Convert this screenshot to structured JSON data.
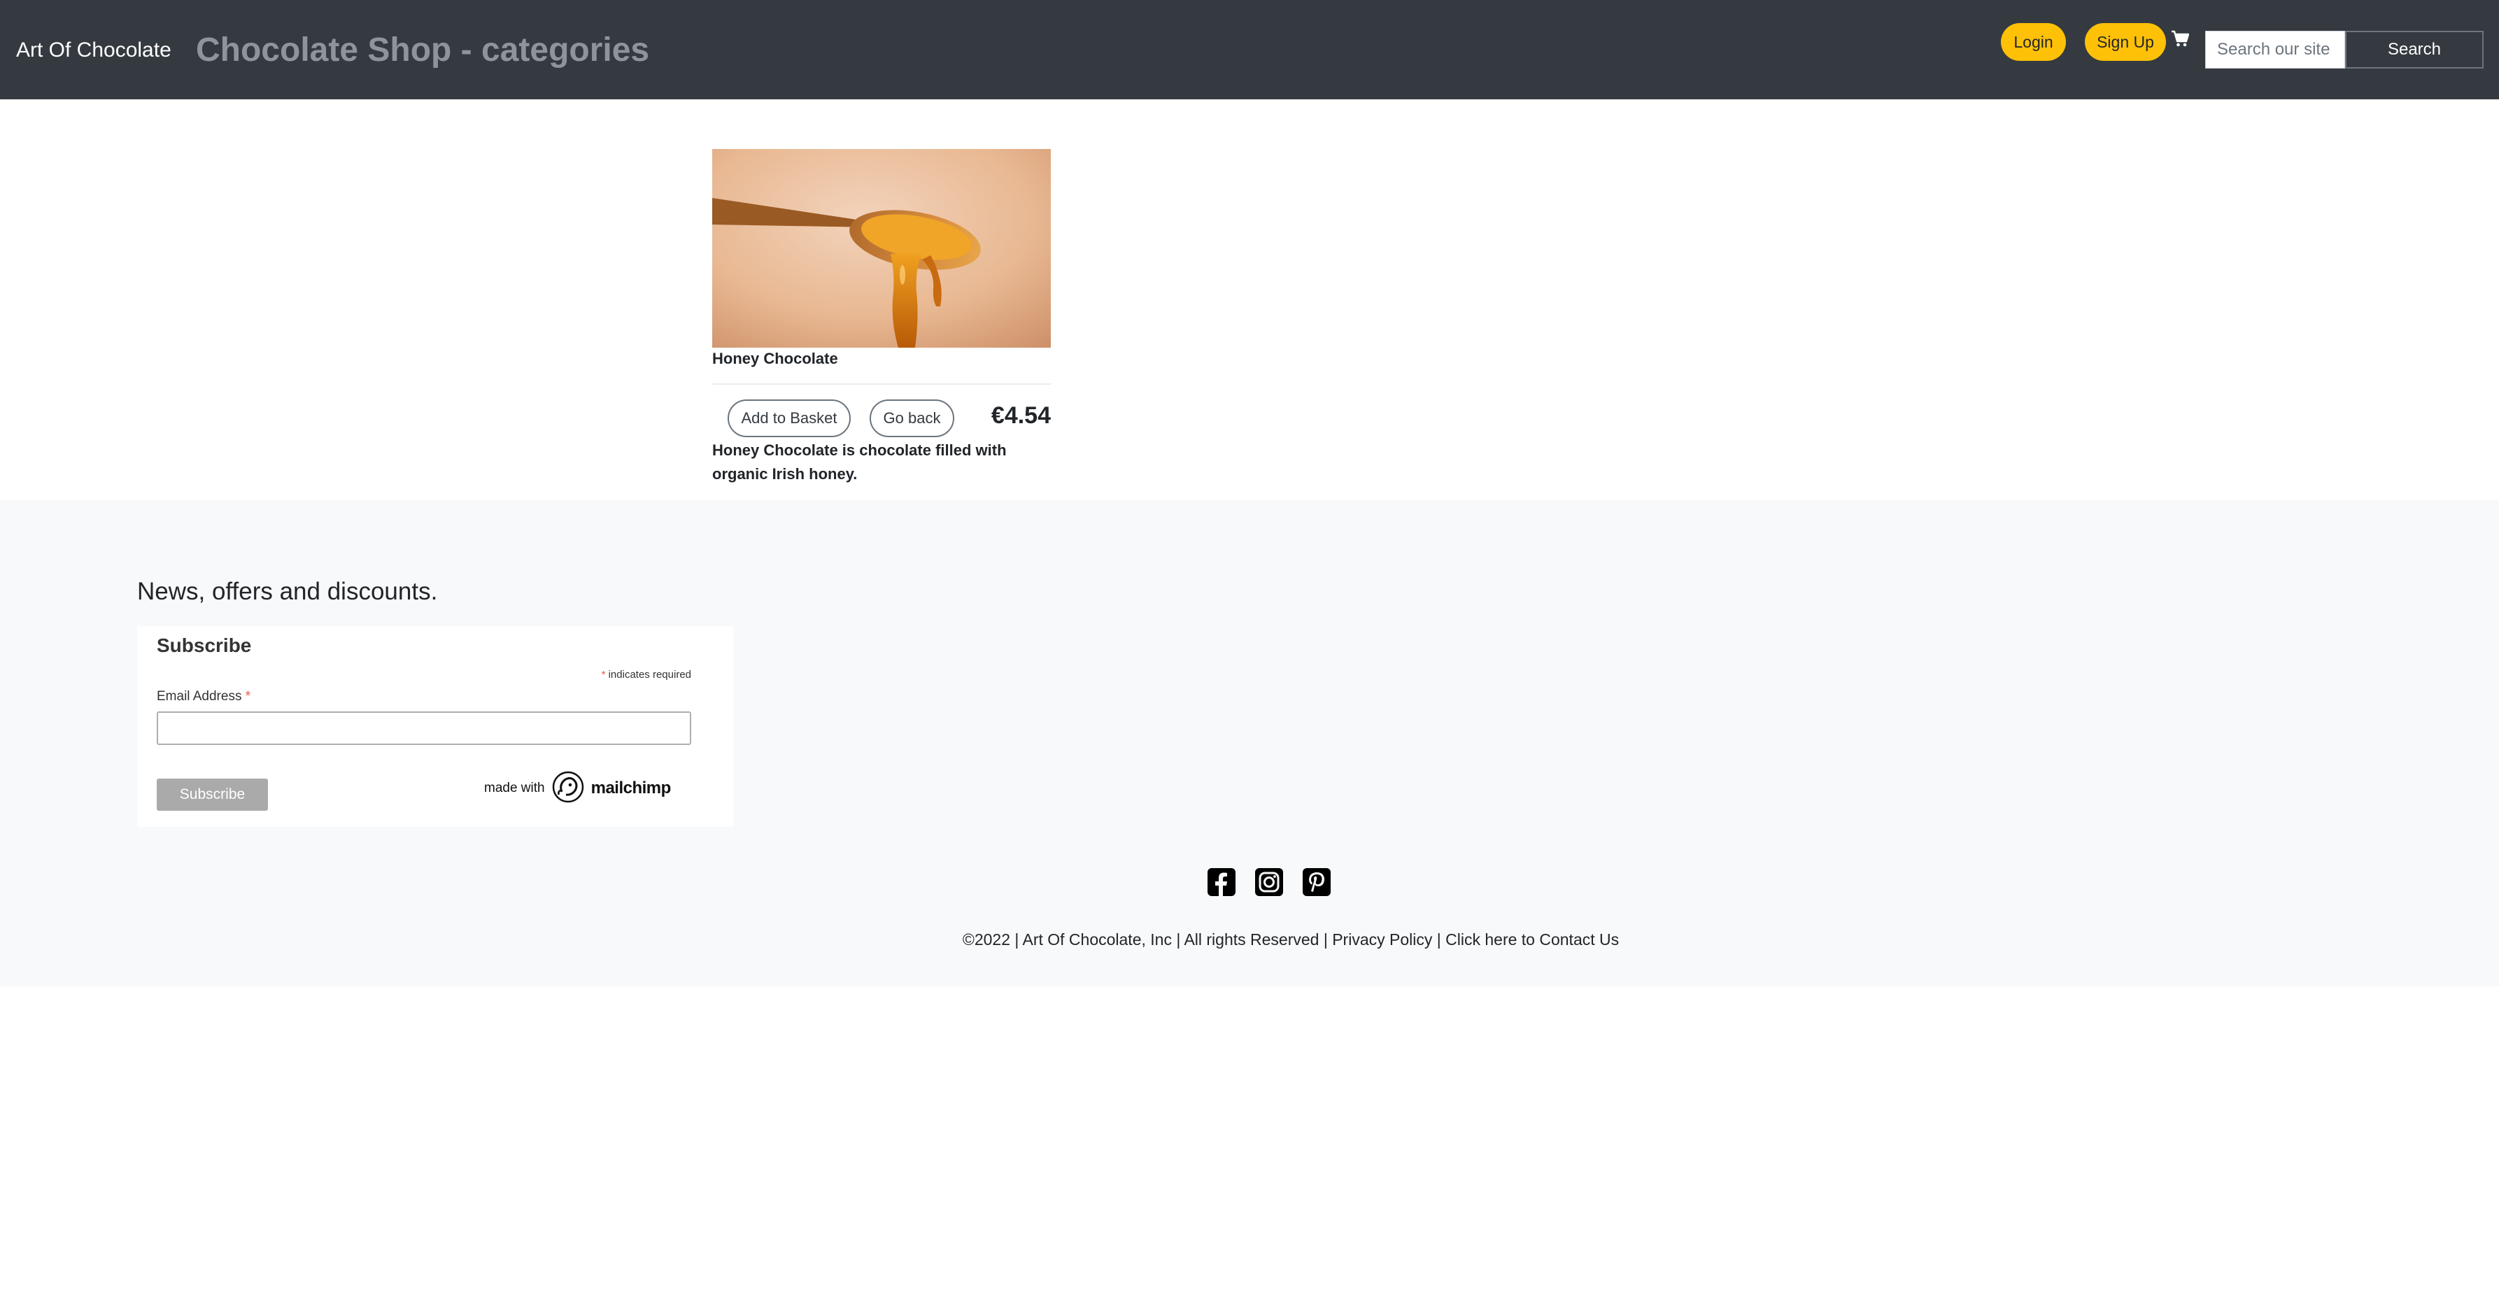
{
  "navbar": {
    "brand": "Art Of Chocolate",
    "heading": "Chocolate Shop - categories",
    "login_label": "Login",
    "signup_label": "Sign Up",
    "cart_icon": "shopping-cart-icon",
    "search_placeholder": "Search our site",
    "search_value": "",
    "search_label": "Search"
  },
  "product": {
    "name": "Honey Chocolate",
    "add_label": "Add to Basket",
    "back_label": "Go back",
    "price": "€4.54",
    "description": "Honey Chocolate is chocolate filled with organic Irish honey."
  },
  "footer": {
    "news_heading": "News, offers and discounts.",
    "form": {
      "title": "Subscribe",
      "required_asterisk": "*",
      "required_note": "indicates required",
      "email_label": "Email Address",
      "email_value": "",
      "subscribe_label": "Subscribe",
      "made_with": "made with",
      "mailchimp": "mailchimp"
    },
    "social": {
      "facebook_icon": "facebook-icon",
      "instagram_icon": "instagram-icon",
      "pinterest_icon": "pinterest-icon"
    },
    "copyright_text": "©2022 | Art Of Chocolate, Inc | All rights Reserved | ",
    "privacy_link": "Privacy Policy",
    "separator": " | ",
    "contact_link": "Click here to Contact Us"
  },
  "colors": {
    "navbar_bg": "#343a40",
    "accent_yellow": "#ffc107",
    "footer_bg": "#f8f9fa",
    "heading_gray": "#8e949a"
  }
}
